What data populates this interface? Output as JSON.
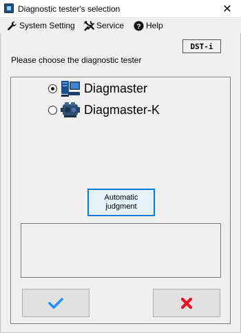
{
  "window": {
    "title": "Diagnostic tester's selection",
    "close_symbol": "✕"
  },
  "menu": {
    "items": [
      {
        "label": "System Setting",
        "icon": "wrench-icon"
      },
      {
        "label": "Service",
        "icon": "tools-icon"
      },
      {
        "label": "Help",
        "icon": "help-icon"
      }
    ]
  },
  "dst_label": "DST-i",
  "prompt": "Please choose the diagnostic tester",
  "options": [
    {
      "label": "Diagmaster",
      "selected": true,
      "icon": "computer-icon"
    },
    {
      "label": "Diagmaster-K",
      "selected": false,
      "icon": "engine-icon"
    }
  ],
  "auto_button": {
    "label": "Automatic\njudgment"
  },
  "colors": {
    "accent_blue": "#0078d7",
    "ok_check": "#1e90ff",
    "cancel_x": "#e81123"
  }
}
